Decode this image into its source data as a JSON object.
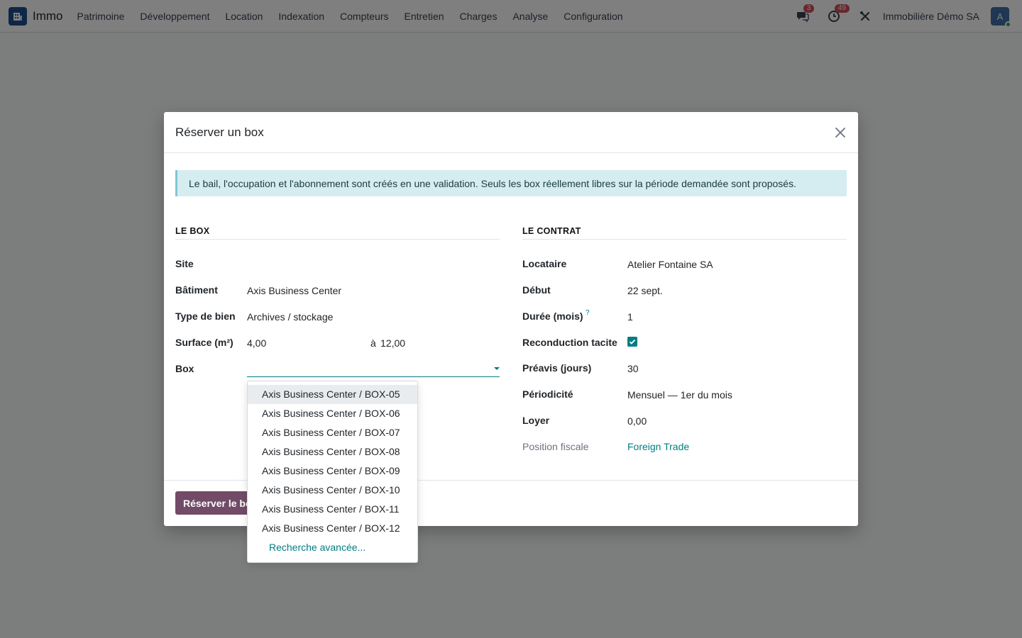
{
  "navbar": {
    "app_name": "Immo",
    "menu": [
      "Patrimoine",
      "Développement",
      "Location",
      "Indexation",
      "Compteurs",
      "Entretien",
      "Charges",
      "Analyse",
      "Configuration"
    ],
    "messages_count": "3",
    "activities_count": "49",
    "company": "Immobilière Démo SA",
    "avatar_letter": "A"
  },
  "modal": {
    "title": "Réserver un box",
    "info": "Le bail, l'occupation et l'abonnement sont créés en une validation. Seuls les box réellement libres sur la période demandée sont proposés.",
    "left_section": {
      "title": "LE BOX",
      "site_label": "Site",
      "site_value": "",
      "building_label": "Bâtiment",
      "building_value": "Axis Business Center",
      "type_label": "Type de bien",
      "type_value": "Archives / stockage",
      "surface_label": "Surface (m²)",
      "surface_min": "4,00",
      "surface_sep": "à",
      "surface_max": "12,00",
      "box_label": "Box",
      "box_value": ""
    },
    "right_section": {
      "title": "LE CONTRAT",
      "tenant_label": "Locataire",
      "tenant_value": "Atelier Fontaine SA",
      "start_label": "Début",
      "start_value": "22 sept.",
      "duration_label": "Durée (mois)",
      "duration_help": "?",
      "duration_value": "1",
      "renewal_label": "Reconduction tacite",
      "renewal_checked": true,
      "notice_label": "Préavis (jours)",
      "notice_value": "30",
      "period_label": "Périodicité",
      "period_value": "Mensuel — 1er du mois",
      "rent_label": "Loyer",
      "rent_value": "0,00",
      "fiscal_label": "Position fiscale",
      "fiscal_value": "Foreign Trade"
    },
    "primary_button": "Réserver le box"
  },
  "dropdown": {
    "items": [
      "Axis Business Center / BOX-05",
      "Axis Business Center / BOX-06",
      "Axis Business Center / BOX-07",
      "Axis Business Center / BOX-08",
      "Axis Business Center / BOX-09",
      "Axis Business Center / BOX-10",
      "Axis Business Center / BOX-11",
      "Axis Business Center / BOX-12"
    ],
    "advanced_search": "Recherche avancée..."
  },
  "colors": {
    "primary": "#714b67",
    "link": "#017e84",
    "badge": "#d44c59",
    "info_bg": "#d5edf0"
  },
  "icons": [
    "building-icon",
    "chat-icon",
    "clock-icon",
    "tools-icon",
    "close-icon",
    "check-icon",
    "caret-down-icon"
  ]
}
